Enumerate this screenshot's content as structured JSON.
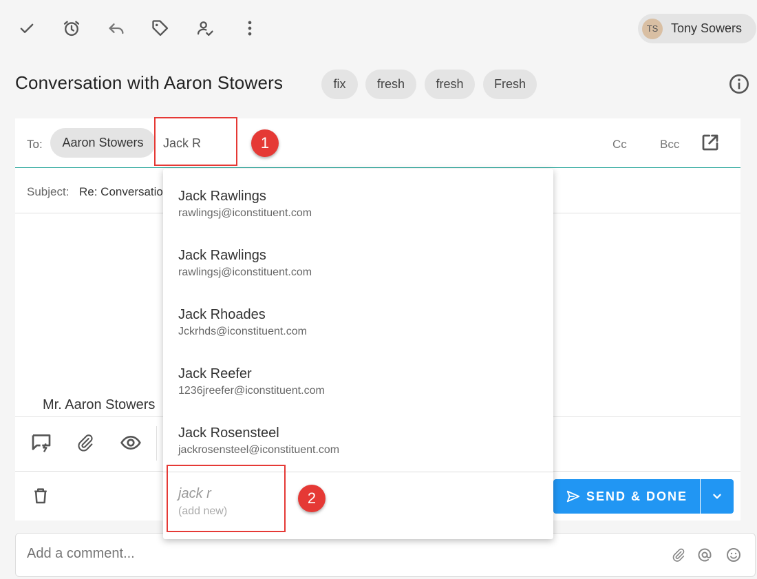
{
  "user": {
    "initials": "TS",
    "name": "Tony Sowers"
  },
  "conversation": {
    "title": "Conversation with Aaron Stowers",
    "tags": [
      "fix",
      "fresh",
      "fresh",
      "Fresh"
    ]
  },
  "compose": {
    "to_label": "To:",
    "recipient": "Aaron Stowers",
    "to_input_value": "Jack R",
    "cc_label": "Cc",
    "bcc_label": "Bcc",
    "subject_label": "Subject:",
    "subject_value": "Re: Conversatio",
    "body_text": "Mr. Aaron Stowers",
    "send_label": "SEND & DONE"
  },
  "dropdown": {
    "items": [
      {
        "name": "Jack Rawlings",
        "email": "rawlingsj@iconstituent.com"
      },
      {
        "name": "Jack Rawlings",
        "email": "rawlingsj@iconstituent.com"
      },
      {
        "name": "Jack Rhoades",
        "email": "Jckrhds@iconstituent.com"
      },
      {
        "name": "Jack Reefer",
        "email": "1236jreefer@iconstituent.com"
      },
      {
        "name": "Jack Rosensteel",
        "email": "jackrosensteel@iconstituent.com"
      }
    ],
    "add_new": {
      "value": "jack r",
      "hint": "(add new)"
    }
  },
  "comment": {
    "placeholder": "Add a comment..."
  },
  "annotations": {
    "badge_1": "1",
    "badge_2": "2"
  },
  "colors": {
    "accent": "#2196f3",
    "divider_active": "#26a69a",
    "annotation": "#e53935"
  },
  "icons": [
    "check-icon",
    "alarm-icon",
    "reply-icon",
    "tag-icon",
    "assign-icon",
    "more-vert-icon",
    "info-icon",
    "open-in-new-icon",
    "quick-reply-icon",
    "attach-icon",
    "eye-icon",
    "trash-icon",
    "send-icon",
    "chevron-down-icon",
    "at-icon",
    "smile-icon"
  ]
}
